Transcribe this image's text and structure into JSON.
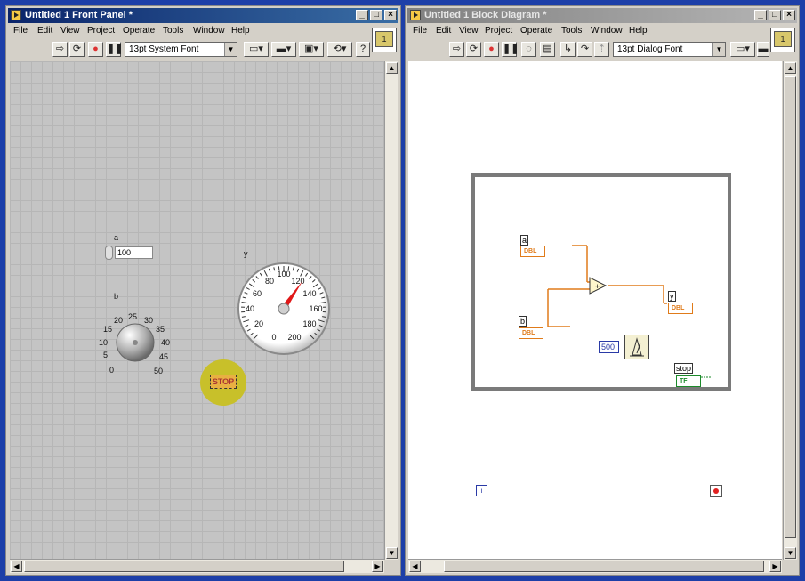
{
  "front_panel": {
    "title": "Untitled 1 Front Panel *",
    "menu": [
      "File",
      "Edit",
      "View",
      "Project",
      "Operate",
      "Tools",
      "Window",
      "Help"
    ],
    "font": "13pt System Font",
    "controls": {
      "a": {
        "label": "a",
        "value": "100"
      },
      "b": {
        "label": "b",
        "scale": [
          "0",
          "5",
          "10",
          "15",
          "20",
          "25",
          "30",
          "35",
          "40",
          "45",
          "50"
        ]
      },
      "y": {
        "label": "y",
        "scale": [
          "0",
          "20",
          "40",
          "60",
          "80",
          "100",
          "120",
          "140",
          "160",
          "180",
          "200"
        ]
      },
      "stop": {
        "label": "stop",
        "button": "STOP"
      }
    },
    "icon_number": "1"
  },
  "block_diagram": {
    "title": "Untitled 1 Block Diagram *",
    "menu": [
      "File",
      "Edit",
      "View",
      "Project",
      "Operate",
      "Tools",
      "Window",
      "Help"
    ],
    "font": "13pt Dialog Font",
    "terminals": {
      "a": {
        "tag": "a",
        "type": "DBL"
      },
      "b": {
        "tag": "b",
        "type": "DBL"
      },
      "y": {
        "tag": "y",
        "type": "DBL"
      },
      "stop": {
        "tag": "stop",
        "type": "TF"
      }
    },
    "wait_constant": "500",
    "iteration": "i",
    "icon_number": "1"
  },
  "colors": {
    "title_active": "#0a246a",
    "numeric_wire": "#e07b1a",
    "boolean_wire": "#1b8a2a",
    "constant": "#2a3aa6"
  }
}
